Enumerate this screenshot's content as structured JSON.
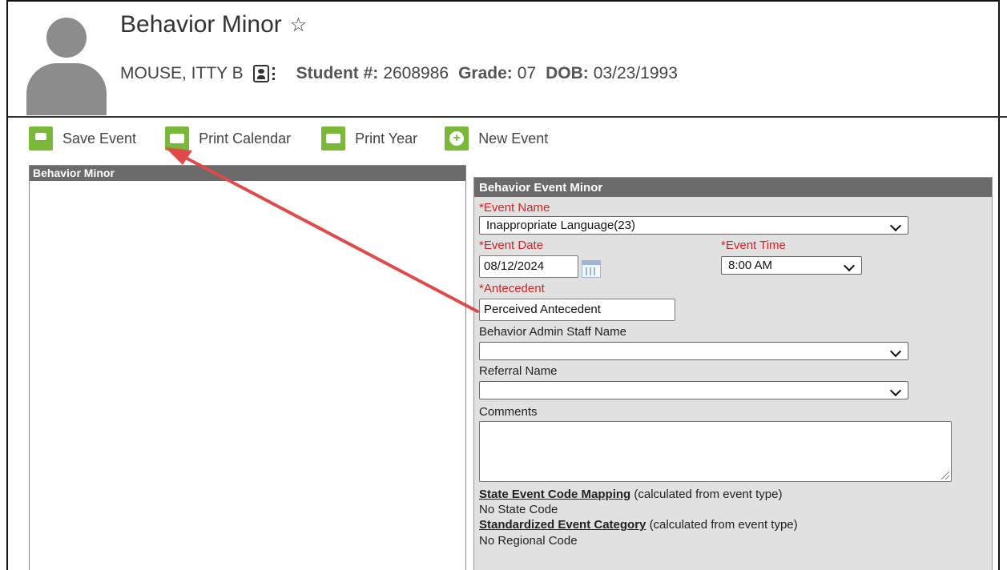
{
  "header": {
    "title": "Behavior Minor",
    "student_name": "MOUSE, ITTY B",
    "student_num_label": "Student #:",
    "student_num": "2608986",
    "grade_label": "Grade:",
    "grade": "07",
    "dob_label": "DOB:",
    "dob": "03/23/1993"
  },
  "toolbar": {
    "save_label": "Save Event",
    "print_calendar_label": "Print Calendar",
    "print_year_label": "Print Year",
    "new_event_label": "New Event",
    "accent_color": "#7ab83a"
  },
  "left_panel": {
    "title": "Behavior Minor"
  },
  "form": {
    "title": "Behavior Event Minor",
    "required_marker": "*",
    "event_name_label": "Event Name",
    "event_name_value": "Inappropriate Language(23)",
    "event_date_label": "Event Date",
    "event_date_value": "08/12/2024",
    "event_time_label": "Event Time",
    "event_time_value": "8:00 AM",
    "antecedent_label": "Antecedent",
    "antecedent_value": "Perceived Antecedent",
    "admin_staff_label": "Behavior Admin Staff Name",
    "admin_staff_value": "",
    "referral_label": "Referral Name",
    "referral_value": "",
    "comments_label": "Comments",
    "comments_value": "",
    "state_mapping_label": "State Event Code Mapping",
    "state_mapping_note": "(calculated from event type)",
    "state_mapping_value": "No State Code",
    "std_category_label": "Standardized Event Category",
    "std_category_note": "(calculated from event type)",
    "std_category_value": "No Regional Code",
    "required_color": "#d32323"
  },
  "annotation": {
    "arrow_color": "#e04a4a"
  }
}
